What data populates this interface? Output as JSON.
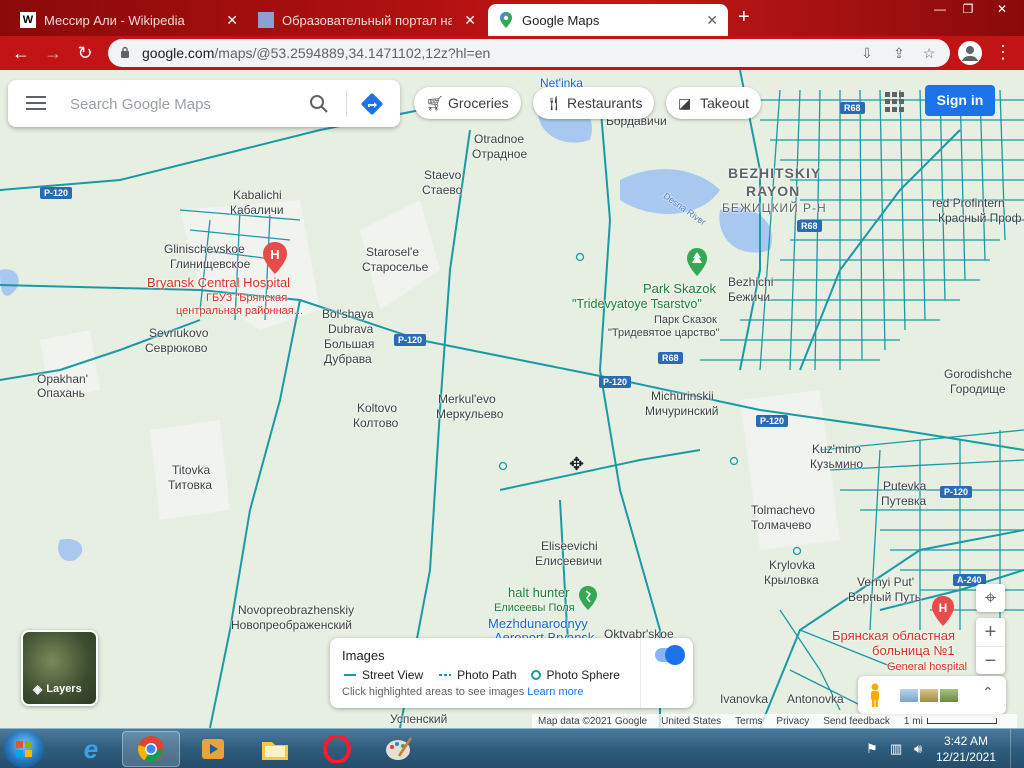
{
  "browser": {
    "tabs": [
      {
        "title": "Мессир Али - Wikipedia",
        "favicon": "W"
      },
      {
        "title": "Образовательный портал на С",
        "favicon": "image"
      },
      {
        "title": "Google Maps",
        "favicon": "maps-pin"
      }
    ],
    "new_tab": "+",
    "url_host": "google.com",
    "url_path": "/maps/@53.2594889,34.1471102,12z?hl=en"
  },
  "search": {
    "placeholder": "Search Google Maps"
  },
  "chips": [
    {
      "label": "Groceries",
      "icon": "cart-icon"
    },
    {
      "label": "Restaurants",
      "icon": "fork-knife-icon"
    },
    {
      "label": "Takeout",
      "icon": "takeout-bag-icon"
    }
  ],
  "sign_in": "Sign in",
  "layers_label": "Layers",
  "images_panel": {
    "title": "Images",
    "legend": [
      "Street View",
      "Photo Path",
      "Photo Sphere"
    ],
    "hint": "Click highlighted areas to see images",
    "learn_more": "Learn more",
    "toggle_on": true
  },
  "attribution": {
    "map_data": "Map data ©2021 Google",
    "country": "United States",
    "terms": "Terms",
    "privacy": "Privacy",
    "feedback": "Send feedback",
    "scale": "1 mi"
  },
  "places": {
    "netinka": "Net'inka",
    "bordavichi": "Бордавичи",
    "otradnoe_en": "Otradnoe",
    "otradnoe_ru": "Отрадное",
    "staevo_en": "Staevo",
    "staevo_ru": "Стаево",
    "kabalichi_en": "Kabalichi",
    "kabalichi_ru": "Кабаличи",
    "glinischevskoe_en": "Glinischevskoe",
    "glinischevskoe_ru": "Глинищевское",
    "hospital_en": "Bryansk Central Hospital",
    "hospital_ru1": "ГБУЗ \"Брянская",
    "hospital_ru2": "центральная районная...",
    "starosele_en": "Starosel'e",
    "starosele_ru": "Староселье",
    "bolshaya_en1": "Bol'shaya",
    "bolshaya_en2": "Dubrava",
    "bolshaya_ru1": "Большая",
    "bolshaya_ru2": "Дубрава",
    "sevriukovo_en": "Sevriukovo",
    "sevriukovo_ru": "Севрюково",
    "opakhan_en": "Opakhan'",
    "opakhan_ru": "Опахань",
    "koltovo_en": "Koltovo",
    "koltovo_ru": "Колтово",
    "merkulevo_en": "Merkul'evo",
    "merkulevo_ru": "Меркульево",
    "titovka_en": "Titovka",
    "titovka_ru": "Титовка",
    "bezhitsky_en1": "BEZHITSKIY",
    "bezhitsky_en2": "RAYON",
    "bezhitsky_ru": "БЕЖИЦКИЙ Р-Н",
    "desna": "Desna River",
    "park_en": "Park Skazok",
    "tsarstvo_en": "\"Tridevyatoye Tsarstvo\"",
    "park_ru": "Парк Сказок",
    "tsarstvo_ru": "\"Тридевятое царство\"",
    "bezhichi_en": "Bezhichi",
    "bezhichi_ru": "Бежичи",
    "profintern_en": "red Profintern",
    "profintern_ru": "Красный Проф",
    "michurinskii_en": "Michurinskii",
    "michurinskii_ru": "Мичуринский",
    "gorodishche_en": "Gorodishche",
    "gorodishche_ru": "Городище",
    "kuzmino_en": "Kuz'mino",
    "kuzmino_ru": "Кузьмино",
    "putevka_en": "Putevka",
    "putevka_ru": "Путевка",
    "tolmachevo_en": "Tolmachevo",
    "tolmachevo_ru": "Толмачево",
    "eliseevichi_en": "Eliseevichi",
    "eliseevichi_ru": "Елисеевичи",
    "krylovka_en": "Krylovka",
    "krylovka_ru": "Крыловка",
    "vernyi_en": "Vernyi Put'",
    "vernyi_ru": "Верный Путь",
    "halt_en": "halt hunter",
    "halt_ru": "Елисеевы Поля",
    "novopre_en": "Novopreobrazhenskiy",
    "novopre_ru": "Новопреображенский",
    "mezhdunarodnyy": "Mezhdunarodnyy",
    "aeroport": "Aeroport Bryansk",
    "oktyabrskoe": "Oktyabr'skoe",
    "uspenskiy": "Успенский",
    "ivanovka": "Ivanovka",
    "antonovka": "Antonovka",
    "bolnitsa_ru1": "Брянская областная",
    "bolnitsa_ru2": "больница №1",
    "general_hospital": "General hospital"
  },
  "road_shields": {
    "p120_a": "P-120",
    "p120_b": "P-120",
    "p120_c": "P-120",
    "p120_d": "P-120",
    "p120_e": "P-120",
    "r68_a": "R68",
    "r68_b": "R68",
    "r68_c": "R68",
    "a240": "A-240"
  },
  "taskbar": {
    "time": "3:42 AM",
    "date": "12/21/2021"
  },
  "colors": {
    "chrome_red": "#c21414",
    "map_bg": "#e6efe2",
    "road": "#1a9aa6",
    "water": "#a8c8f0",
    "brand_blue": "#1a73e8"
  }
}
